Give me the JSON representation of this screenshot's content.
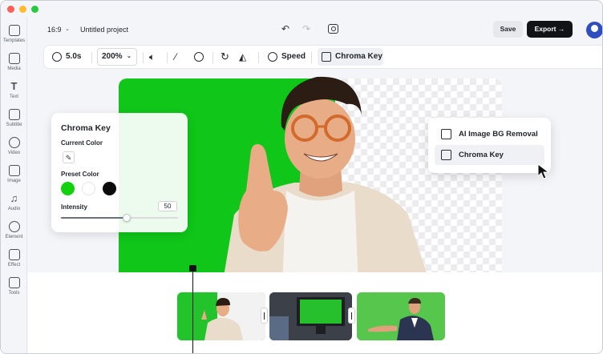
{
  "window_controls": {
    "close_color": "#ff5f57",
    "minimize_color": "#febc2e",
    "maximize_color": "#28c840"
  },
  "sidebar": {
    "items": [
      {
        "label": "Templates",
        "icon": "templates-icon"
      },
      {
        "label": "Media",
        "icon": "media-icon"
      },
      {
        "label": "Text",
        "icon": "text-icon"
      },
      {
        "label": "Subtitle",
        "icon": "subtitle-icon"
      },
      {
        "label": "Video",
        "icon": "video-icon"
      },
      {
        "label": "Image",
        "icon": "image-icon"
      },
      {
        "label": "Audio",
        "icon": "audio-icon"
      },
      {
        "label": "Element",
        "icon": "element-icon"
      },
      {
        "label": "Effect",
        "icon": "effect-icon"
      },
      {
        "label": "Tools",
        "icon": "tools-icon"
      }
    ]
  },
  "header": {
    "aspect_ratio": "16:9",
    "project_title": "Untitled project",
    "save_label": "Save",
    "export_label": "Export",
    "export_arrow": "→"
  },
  "toolbar": {
    "duration": "5.0s",
    "zoom": "200%",
    "speed_label": "Speed",
    "chroma_key_label": "Chroma Key"
  },
  "chroma_panel": {
    "title": "Chroma Key",
    "current_color_label": "Current Color",
    "preset_color_label": "Preset Color",
    "preset_colors": [
      "#12d10f",
      "#ffffff",
      "#0b0b0b"
    ],
    "intensity_label": "Intensity",
    "intensity_value": "50",
    "intensity_fraction": 0.56
  },
  "context_menu": {
    "items": [
      {
        "label": "AI Image BG Removal",
        "icon": "eraser-icon"
      },
      {
        "label": "Chroma Key",
        "icon": "chroma-key-icon"
      }
    ]
  },
  "colors": {
    "green_screen": "#10c619",
    "accent_dark": "#111317"
  }
}
